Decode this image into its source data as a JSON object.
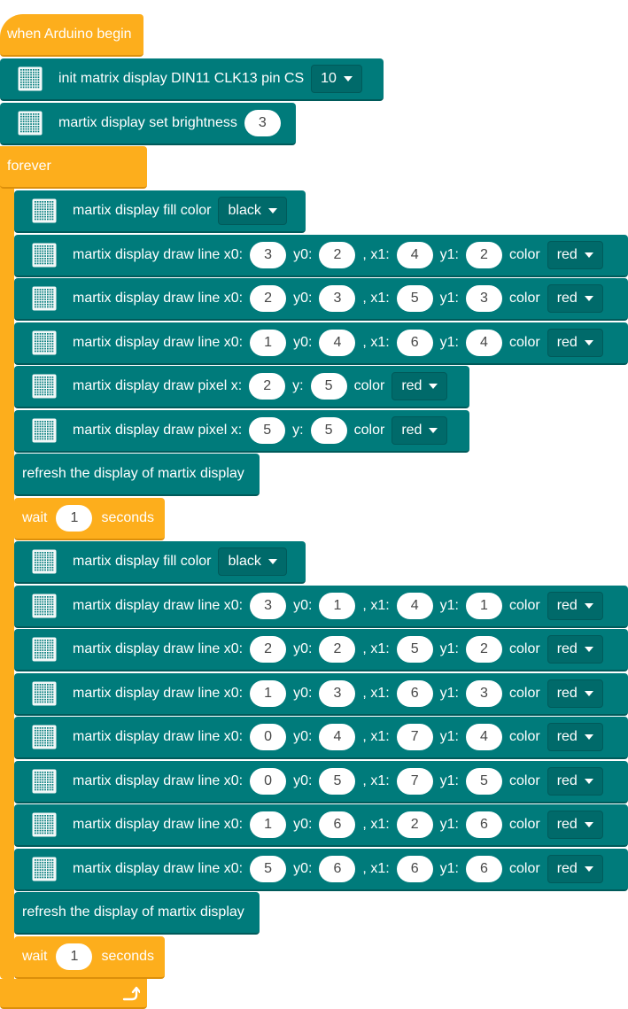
{
  "colors": {
    "control_block": "#fdae1c",
    "display_block": "#007b7b",
    "display_block_dark": "#005a5a",
    "input_text": "#474747"
  },
  "icons": {
    "matrix": "led-matrix-icon",
    "loop": "loop-arrow-icon"
  },
  "hat": {
    "label": "when Arduino begin"
  },
  "setup": {
    "init_prefix": "init matrix display DIN11 CLK13 pin CS",
    "cs_value": "10",
    "brightness_label": "martix display set brightness",
    "brightness_value": "3"
  },
  "forever": {
    "label": "forever",
    "groups": [
      {
        "fill_label": "martix display fill color",
        "fill_value": "black",
        "lines": [
          {
            "x0": "3",
            "y0": "2",
            "x1": "4",
            "y1": "2",
            "color": "red"
          },
          {
            "x0": "2",
            "y0": "3",
            "x1": "5",
            "y1": "3",
            "color": "red"
          },
          {
            "x0": "1",
            "y0": "4",
            "x1": "6",
            "y1": "4",
            "color": "red"
          }
        ],
        "pixels": [
          {
            "x": "2",
            "y": "5",
            "color": "red"
          },
          {
            "x": "5",
            "y": "5",
            "color": "red"
          }
        ],
        "refresh_label": "refresh the display of martix display",
        "wait": {
          "prefix": "wait",
          "value": "1",
          "suffix": "seconds"
        }
      },
      {
        "fill_label": "martix display fill color",
        "fill_value": "black",
        "lines": [
          {
            "x0": "3",
            "y0": "1",
            "x1": "4",
            "y1": "1",
            "color": "red"
          },
          {
            "x0": "2",
            "y0": "2",
            "x1": "5",
            "y1": "2",
            "color": "red"
          },
          {
            "x0": "1",
            "y0": "3",
            "x1": "6",
            "y1": "3",
            "color": "red"
          },
          {
            "x0": "0",
            "y0": "4",
            "x1": "7",
            "y1": "4",
            "color": "red"
          },
          {
            "x0": "0",
            "y0": "5",
            "x1": "7",
            "y1": "5",
            "color": "red"
          },
          {
            "x0": "1",
            "y0": "6",
            "x1": "2",
            "y1": "6",
            "color": "red"
          },
          {
            "x0": "5",
            "y0": "6",
            "x1": "6",
            "y1": "6",
            "color": "red"
          }
        ],
        "pixels": [],
        "refresh_label": "refresh the display of martix display",
        "wait": {
          "prefix": "wait",
          "value": "1",
          "suffix": "seconds"
        }
      }
    ]
  },
  "labels": {
    "draw_line": "martix display draw line x0:",
    "y0": "y0:",
    "x1": ", x1:",
    "y1": "y1:",
    "color": "color",
    "draw_pixel": "martix display draw pixel x:",
    "y": "y:"
  }
}
